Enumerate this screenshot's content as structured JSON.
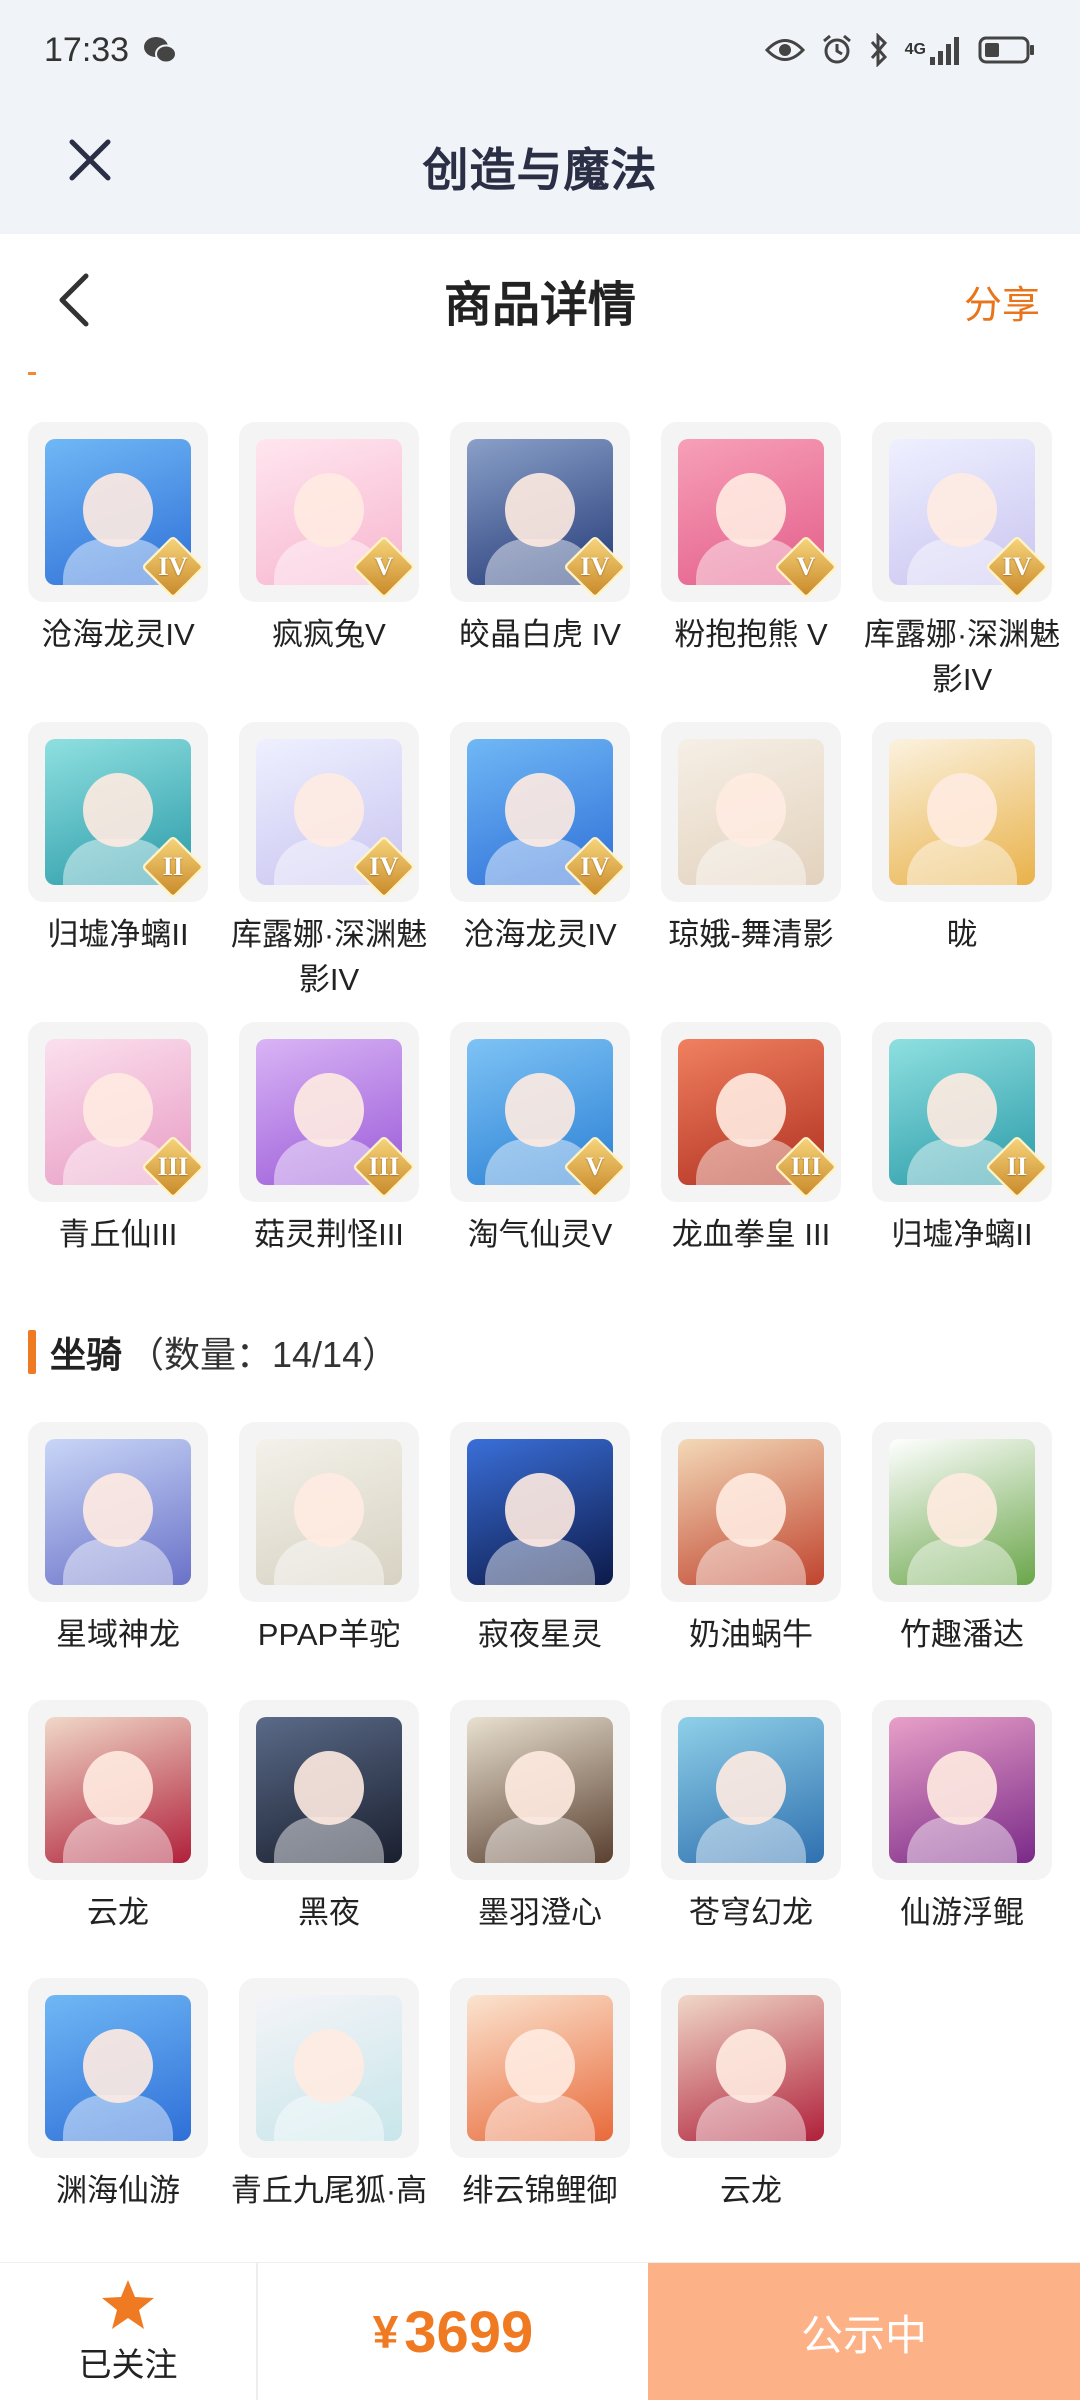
{
  "status_bar": {
    "time": "17:33",
    "network": "4G"
  },
  "app_bar": {
    "title": "创造与魔法"
  },
  "detail_header": {
    "title": "商品详情",
    "share": "分享"
  },
  "colors": {
    "accent": "#f07a22",
    "status_button_bg": "#fdb186",
    "app_bar_bg": "#f0f3f7"
  },
  "characters": [
    {
      "name": "沧海龙灵IV",
      "rank": "IV",
      "color_a": "#6fb8f5",
      "color_b": "#2f6fd8"
    },
    {
      "name": "疯疯兔V",
      "rank": "V",
      "color_a": "#ffe6ef",
      "color_b": "#f7b5cf"
    },
    {
      "name": "皎晶白虎 IV",
      "rank": "IV",
      "color_a": "#8aa0c8",
      "color_b": "#243a78"
    },
    {
      "name": "粉抱抱熊 V",
      "rank": "V",
      "color_a": "#f7a0b8",
      "color_b": "#e35d8a"
    },
    {
      "name": "库露娜·深渊魅影IV",
      "rank": "IV",
      "color_a": "#eef0ff",
      "color_b": "#c9c4f0"
    },
    {
      "name": "归墟净螭II",
      "rank": "II",
      "color_a": "#8fe0e0",
      "color_b": "#2a9aa8"
    },
    {
      "name": "库露娜·深渊魅影IV",
      "rank": "IV",
      "color_a": "#eef0ff",
      "color_b": "#c9c4f0"
    },
    {
      "name": "沧海龙灵IV",
      "rank": "IV",
      "color_a": "#6fb8f5",
      "color_b": "#2f6fd8"
    },
    {
      "name": "琼娥-舞清影",
      "rank": "",
      "color_a": "#f6efe6",
      "color_b": "#e2d2bd"
    },
    {
      "name": "昽",
      "rank": "",
      "color_a": "#fbf2df",
      "color_b": "#e9b24a"
    },
    {
      "name": "青丘仙III",
      "rank": "III",
      "color_a": "#fbe0ee",
      "color_b": "#e89bc3"
    },
    {
      "name": "菇灵荆怪III",
      "rank": "III",
      "color_a": "#d9b4f5",
      "color_b": "#9a5ad8"
    },
    {
      "name": "淘气仙灵V",
      "rank": "V",
      "color_a": "#7ec3f5",
      "color_b": "#2a7fd4"
    },
    {
      "name": "龙血拳皇 III",
      "rank": "III",
      "color_a": "#f08060",
      "color_b": "#b03020"
    },
    {
      "name": "归墟净螭II",
      "rank": "II",
      "color_a": "#8fe0e0",
      "color_b": "#2a9aa8"
    }
  ],
  "mounts_section": {
    "title": "坐骑",
    "count": "（数量：14/14）"
  },
  "mounts": [
    {
      "name": "星域神龙",
      "color_a": "#c9d6f7",
      "color_b": "#6a72c8"
    },
    {
      "name": "PPAP羊驼",
      "color_a": "#f3f1ea",
      "color_b": "#d7d2c2"
    },
    {
      "name": "寂夜星灵",
      "color_a": "#3a6fd8",
      "color_b": "#0d1a4a"
    },
    {
      "name": "奶油蜗牛",
      "color_a": "#f3d9b8",
      "color_b": "#c0442e"
    },
    {
      "name": "竹趣潘达",
      "color_a": "#ffffff",
      "color_b": "#6aa64a"
    },
    {
      "name": "云龙",
      "color_a": "#f0d8c8",
      "color_b": "#b0203a"
    },
    {
      "name": "黑夜",
      "color_a": "#5a6a88",
      "color_b": "#1a1f2e"
    },
    {
      "name": "墨羽澄心",
      "color_a": "#e8e0d0",
      "color_b": "#5a4030"
    },
    {
      "name": "苍穹幻龙",
      "color_a": "#8fd0e8",
      "color_b": "#2f70b0"
    },
    {
      "name": "仙游浮鲲",
      "color_a": "#e8a0c8",
      "color_b": "#7a2a88"
    },
    {
      "name": "渊海仙游",
      "color_a": "#6fb8f5",
      "color_b": "#2f6fd8"
    },
    {
      "name": "青丘九尾狐·高",
      "color_a": "#f4f4f8",
      "color_b": "#c8e6ea"
    },
    {
      "name": "绯云锦鲤御",
      "color_a": "#fbe4d0",
      "color_b": "#e86a3a"
    },
    {
      "name": "云龙",
      "color_a": "#f0d8c8",
      "color_b": "#b0203a"
    }
  ],
  "bottom_bar": {
    "follow_label": "已关注",
    "price_symbol": "¥",
    "price": "3699",
    "status_button": "公示中"
  }
}
